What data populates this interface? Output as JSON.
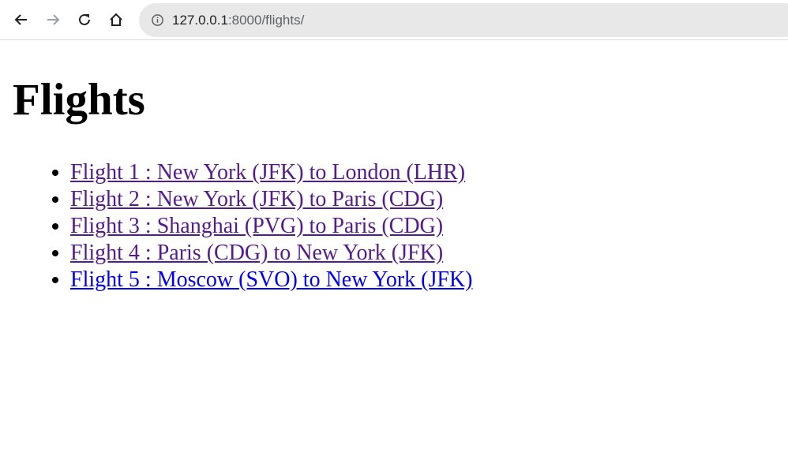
{
  "browser": {
    "url_host": "127.0.0.1",
    "url_rest": ":8000/flights/"
  },
  "page": {
    "title": "Flights",
    "flights": [
      {
        "label": "Flight 1 : New York (JFK) to London (LHR)",
        "visited": true
      },
      {
        "label": "Flight 2 : New York (JFK) to Paris (CDG)",
        "visited": true
      },
      {
        "label": "Flight 3 : Shanghai (PVG) to Paris (CDG)",
        "visited": true
      },
      {
        "label": "Flight 4 : Paris (CDG) to New York (JFK)",
        "visited": true
      },
      {
        "label": "Flight 5 : Moscow (SVO) to New York (JFK)",
        "visited": false
      }
    ]
  },
  "colors": {
    "visited_link": "#551a8b",
    "unvisited_link": "#0000ee",
    "omnibox_bg": "#e8e8e8"
  },
  "icons": [
    "back-arrow-icon",
    "forward-arrow-icon",
    "reload-icon",
    "home-icon",
    "info-icon"
  ]
}
